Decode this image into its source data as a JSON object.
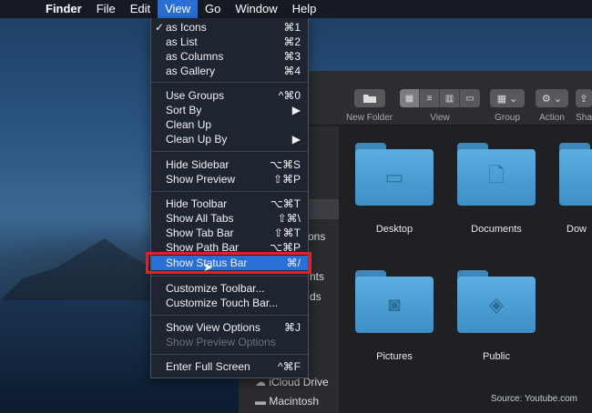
{
  "menubar": {
    "apple_icon": "apple-logo",
    "items": [
      "Finder",
      "File",
      "Edit",
      "View",
      "Go",
      "Window",
      "Help"
    ],
    "active": "View"
  },
  "view_menu": {
    "items": [
      {
        "label": "as Icons",
        "shortcut": "⌘1",
        "checked": true
      },
      {
        "label": "as List",
        "shortcut": "⌘2"
      },
      {
        "label": "as Columns",
        "shortcut": "⌘3"
      },
      {
        "label": "as Gallery",
        "shortcut": "⌘4"
      },
      {
        "label": "Use Groups",
        "shortcut": "^⌘0"
      },
      {
        "label": "Sort By",
        "shortcut": "▶"
      },
      {
        "label": "Clean Up",
        "shortcut": ""
      },
      {
        "label": "Clean Up By",
        "shortcut": "▶"
      },
      {
        "label": "Hide Sidebar",
        "shortcut": "⌥⌘S"
      },
      {
        "label": "Show Preview",
        "shortcut": "⇧⌘P"
      },
      {
        "label": "Hide Toolbar",
        "shortcut": "⌥⌘T"
      },
      {
        "label": "Show All Tabs",
        "shortcut": "⇧⌘\\"
      },
      {
        "label": "Show Tab Bar",
        "shortcut": "⇧⌘T"
      },
      {
        "label": "Show Path Bar",
        "shortcut": "⌥⌘P"
      },
      {
        "label": "Show Status Bar",
        "shortcut": "⌘/",
        "highlighted": true
      },
      {
        "label": "Customize Toolbar...",
        "shortcut": ""
      },
      {
        "label": "Customize Touch Bar...",
        "shortcut": ""
      },
      {
        "label": "Show View Options",
        "shortcut": "⌘J"
      },
      {
        "label": "Show Preview Options",
        "shortcut": "",
        "disabled": true
      },
      {
        "label": "Enter Full Screen",
        "shortcut": "^⌘F"
      }
    ]
  },
  "finder": {
    "toolbar": {
      "new_folder": "New Folder",
      "view": "View",
      "group": "Group",
      "action": "Action",
      "share": "Sha"
    },
    "sidebar": {
      "partial_items": [
        "ons",
        "nts",
        "ds"
      ],
      "items": [
        "iCloud Drive",
        "Macintosh"
      ]
    },
    "folders": [
      {
        "label": "Desktop",
        "icon": "desktop-icon"
      },
      {
        "label": "Documents",
        "icon": "document-icon"
      },
      {
        "label": "Dow",
        "icon": "download-icon"
      },
      {
        "label": "Pictures",
        "icon": "camera-icon"
      },
      {
        "label": "Public",
        "icon": "public-sign-icon"
      }
    ]
  },
  "colors": {
    "accent": "#2a6fd6",
    "highlight_box": "#e0202a",
    "folder": "#4a9fd5"
  },
  "source": "Source: Youtube.com"
}
